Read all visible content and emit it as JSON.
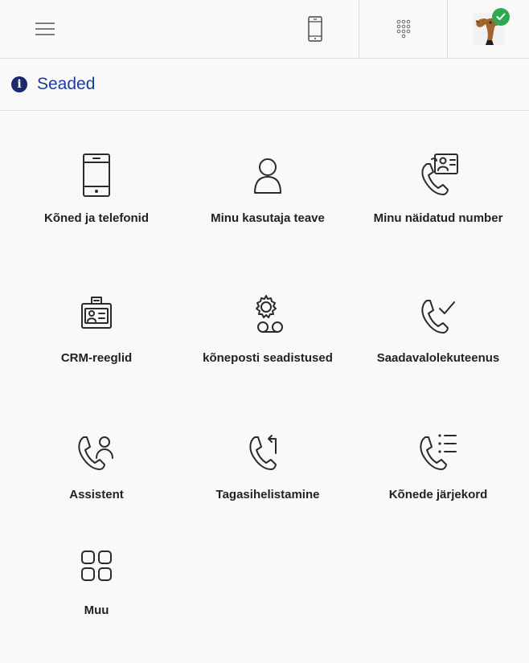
{
  "header": {
    "title": "Seaded"
  },
  "icons": {
    "menu": "hamburger-menu-icon",
    "phone": "mobile-phone-icon",
    "dialpad": "dialpad-icon",
    "info": "info-icon",
    "status": "online-status-icon"
  },
  "colors": {
    "title": "#1c3c9c",
    "info_badge": "#1a2a6c",
    "status_online": "#2fa84f"
  },
  "tiles": [
    {
      "label": "Kõned ja telefonid",
      "icon": "phone-device-icon"
    },
    {
      "label": "Minu kasutaja teave",
      "icon": "user-profile-icon"
    },
    {
      "label": "Minu näidatud number",
      "icon": "caller-id-icon"
    },
    {
      "label": "CRM-reeglid",
      "icon": "crm-badge-icon"
    },
    {
      "label": "kõneposti seadistused",
      "icon": "voicemail-settings-icon"
    },
    {
      "label": "Saadavalolekuteenus",
      "icon": "availability-call-icon"
    },
    {
      "label": "Assistent",
      "icon": "assistant-call-icon"
    },
    {
      "label": "Tagasihelistamine",
      "icon": "callback-icon"
    },
    {
      "label": "Kõnede järjekord",
      "icon": "call-queue-icon"
    },
    {
      "label": "Muu",
      "icon": "more-grid-icon"
    }
  ]
}
